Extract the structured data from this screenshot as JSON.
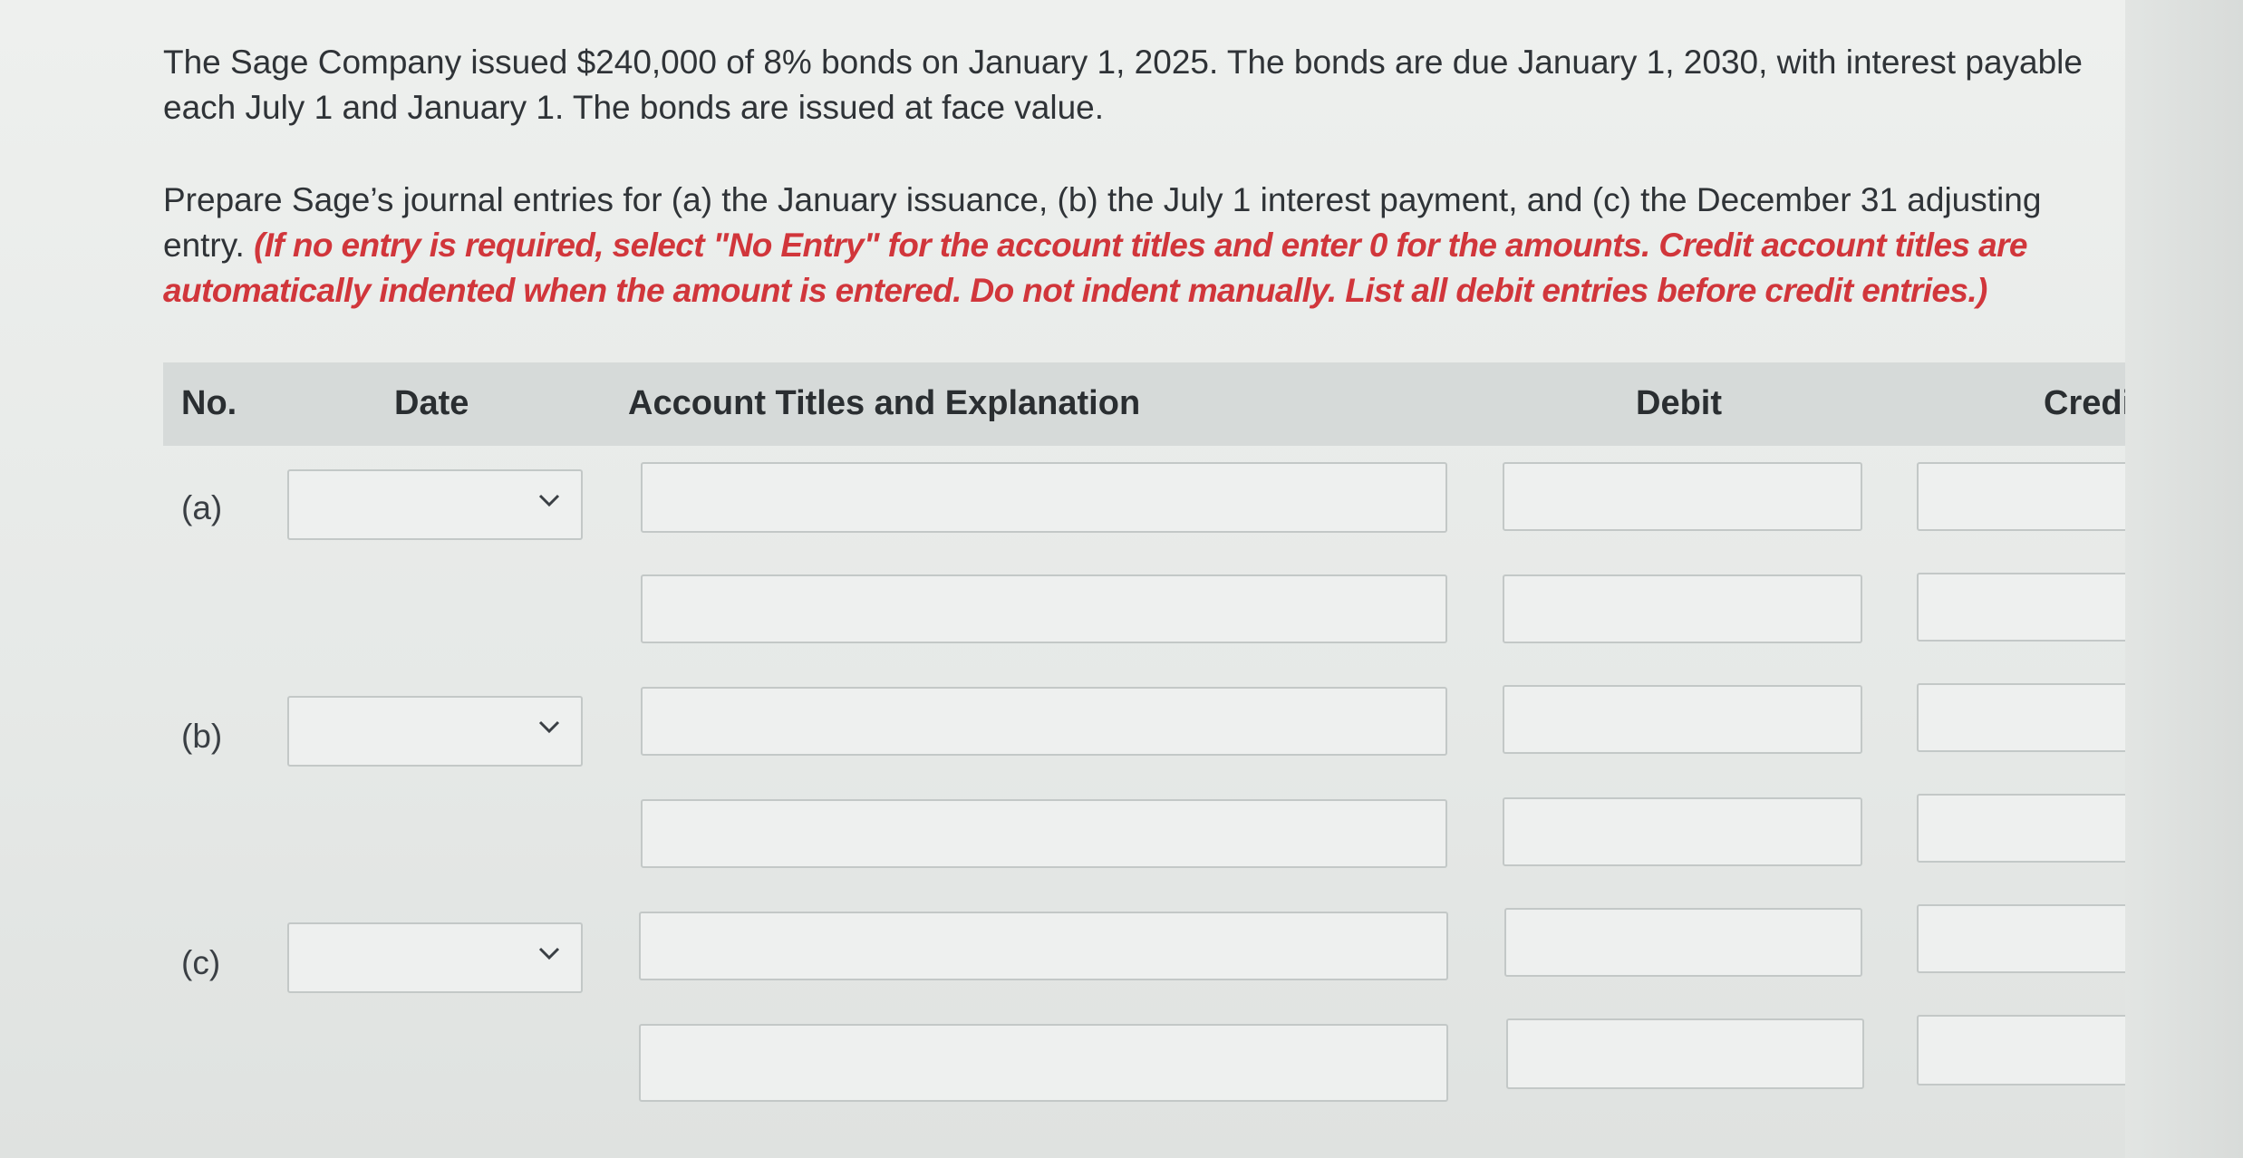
{
  "question": {
    "paragraph1": "The Sage Company issued $240,000 of 8% bonds on January 1, 2025. The bonds are due January 1, 2030, with interest payable each July 1 and January 1. The bonds are issued at face value.",
    "paragraph2_plain": "Prepare Sage’s journal entries for (a) the January issuance, (b) the July 1 interest payment, and (c) the December 31 adjusting entry. ",
    "paragraph2_instruction": "(If no entry is required, select \"No Entry\" for the account titles and enter 0 for the amounts. Credit account titles are automatically indented when the amount is entered. Do not indent manually. List all debit entries before credit entries.)"
  },
  "table": {
    "headers": {
      "no": "No.",
      "date": "Date",
      "account": "Account Titles and Explanation",
      "debit": "Debit",
      "credit": "Credi"
    },
    "rows": [
      {
        "label": "(a)",
        "date_value": "",
        "account_values": [
          "",
          ""
        ],
        "debit_values": [
          "",
          ""
        ],
        "credit_values": [
          "",
          ""
        ]
      },
      {
        "label": "(b)",
        "date_value": "",
        "account_values": [
          "",
          ""
        ],
        "debit_values": [
          "",
          ""
        ],
        "credit_values": [
          "",
          ""
        ]
      },
      {
        "label": "(c)",
        "date_value": "",
        "account_values": [
          "",
          ""
        ],
        "debit_values": [
          "",
          ""
        ],
        "credit_values": [
          "",
          ""
        ]
      }
    ]
  },
  "colors": {
    "instruction_red": "#d1363b",
    "header_bg": "#d6dad9",
    "field_border": "#c3c8c7"
  },
  "icons": {
    "date_dropdown": "chevron-down-icon"
  }
}
